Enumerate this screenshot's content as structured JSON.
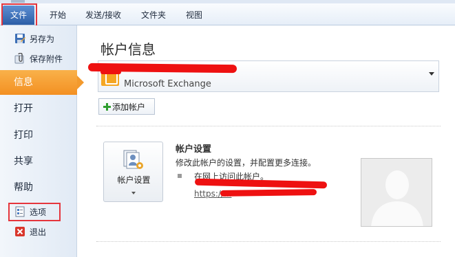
{
  "ribbon": {
    "tabs": [
      {
        "label": "文件",
        "active": true
      },
      {
        "label": "开始"
      },
      {
        "label": "发送/接收"
      },
      {
        "label": "文件夹"
      },
      {
        "label": "视图"
      }
    ]
  },
  "nav": {
    "save_as": "另存为",
    "save_attachments": "保存附件",
    "info": "信息",
    "open": "打开",
    "print": "打印",
    "share": "共享",
    "help": "帮助",
    "options": "选项",
    "exit": "退出"
  },
  "main": {
    "page_title": "帐户信息",
    "account": {
      "name": "",
      "type": "Microsoft Exchange"
    },
    "add_account_label": "添加帐户",
    "account_settings": {
      "button_label": "帐户设置",
      "title": "帐户设置",
      "description": "修改此帐户的设置，并配置更多连接。",
      "bullet": "在网上访问此帐户。",
      "link": "https://..."
    }
  },
  "colors": {
    "file_tab": "#2c5ea6",
    "active_nav": "#f39022",
    "highlight_box": "#e5353c",
    "redaction": "#ee1111"
  },
  "icons": {
    "save_as": "save-as-icon",
    "save_attachments": "paperclip-icon",
    "options": "options-icon",
    "exit": "exit-icon",
    "account": "exchange-account-icon",
    "add": "plus-icon",
    "account_settings": "account-settings-icon",
    "photo": "user-silhouette-icon"
  }
}
